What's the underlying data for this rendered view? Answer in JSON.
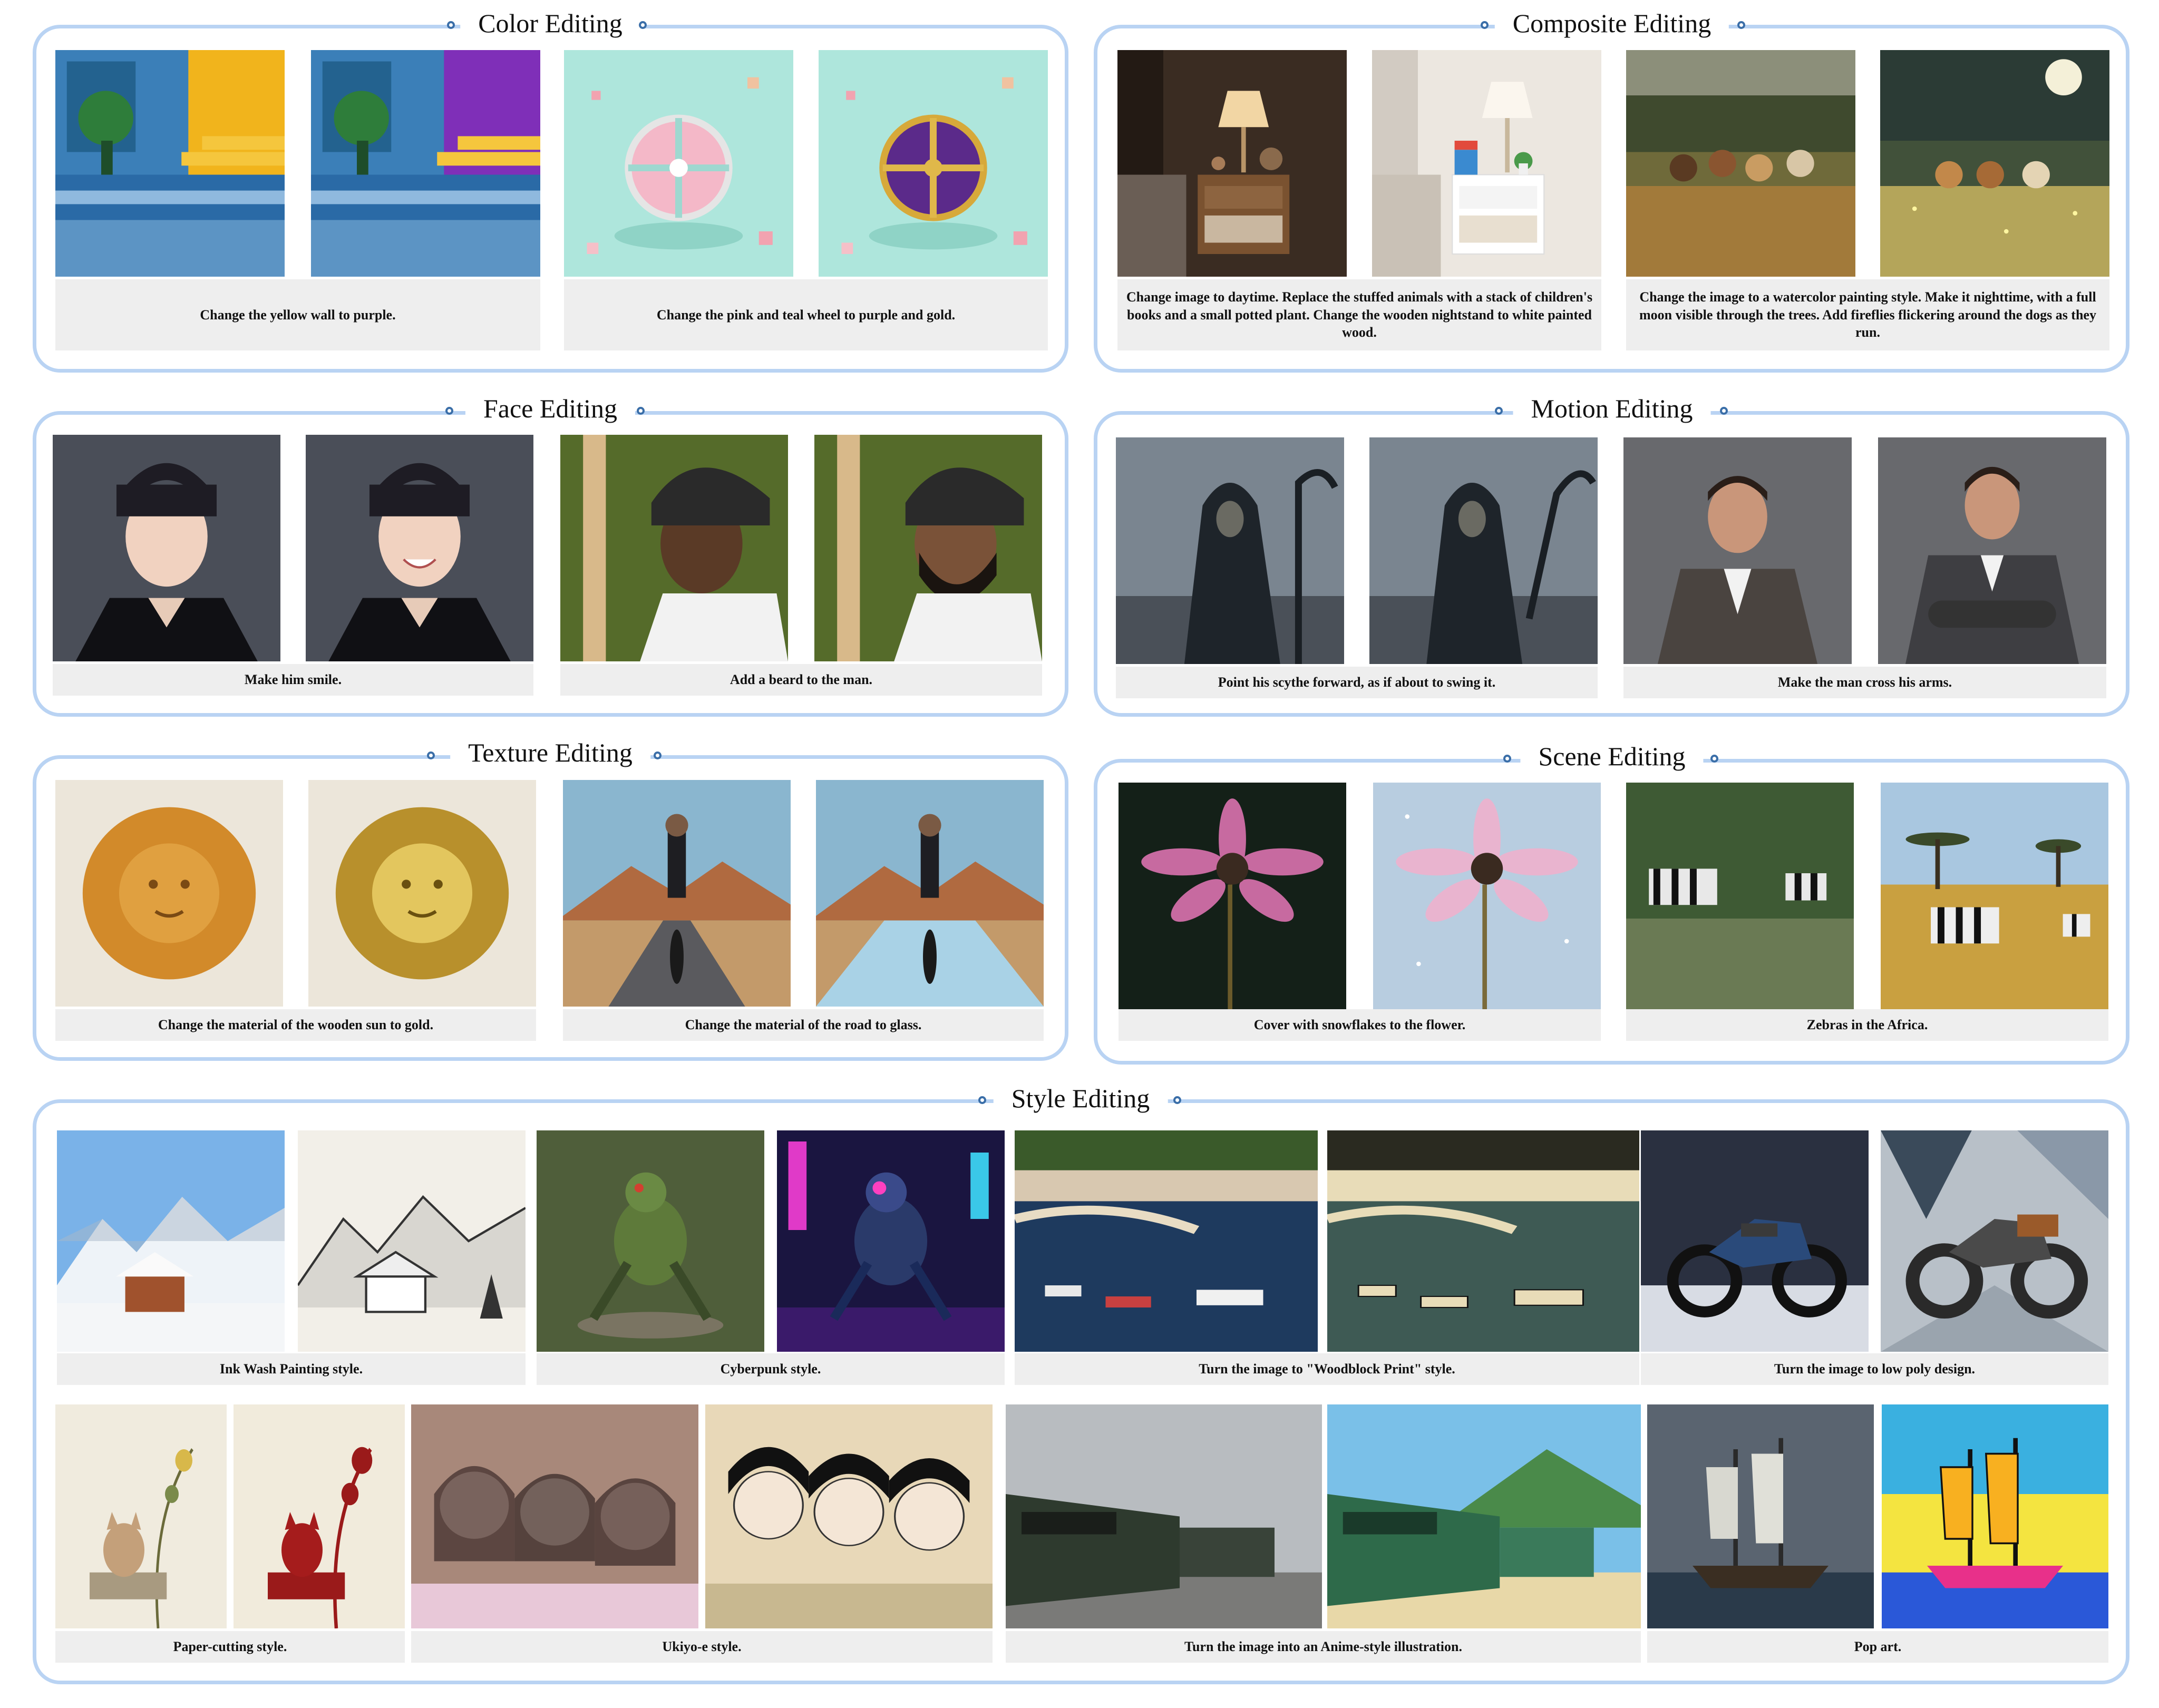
{
  "panels": {
    "color": {
      "title": "Color Editing",
      "captions": [
        "Change the yellow wall to purple.",
        "Change the pink and teal wheel to purple and gold."
      ]
    },
    "composite": {
      "title": "Composite Editing",
      "captions": [
        "Change image to daytime. Replace the stuffed animals  with a stack of children's books and a small potted plant. Change the wooden nightstand to white painted wood.",
        "Change the image to a watercolor painting style. Make it nighttime, with a full moon visible through the trees. Add fireflies flickering around the dogs as they run."
      ]
    },
    "face": {
      "title": "Face Editing",
      "captions": [
        "Make him smile.",
        "Add a beard to the man."
      ]
    },
    "motion": {
      "title": "Motion Editing",
      "captions": [
        "Point his scythe forward, as if about to swing it.",
        "Make the man cross his arms."
      ]
    },
    "texture": {
      "title": "Texture Editing",
      "captions": [
        "Change the material of the wooden sun to gold.",
        "Change the material of the road to glass."
      ]
    },
    "scene": {
      "title": "Scene Editing",
      "captions": [
        "Cover with snowflakes to the flower.",
        "Zebras in the Africa."
      ]
    },
    "style": {
      "title": "Style Editing",
      "row1": [
        "Ink Wash Painting style.",
        "Cyberpunk style.",
        "Turn the image to \"Woodblock Print\" style.",
        "Turn the image to low poly design."
      ],
      "row2": [
        "Paper-cutting style.",
        "Ukiyo-e style.",
        "Turn the image into an Anime-style illustration.",
        "Pop art."
      ]
    }
  },
  "colors": {
    "panel_border": "#b9d3f3",
    "caption_bg": "#eeeeee",
    "title_dot": "#3a6ea8"
  },
  "images": [
    "pool-yellow-wall",
    "pool-purple-wall",
    "pink-teal-wheel",
    "purple-gold-wheel",
    "bedroom-night",
    "bedroom-day",
    "dogs-running",
    "dogs-watercolor-night",
    "anime-boy",
    "anime-boy-smiling",
    "baseball-player",
    "baseball-player-beard",
    "reaper",
    "reaper-scythe-forward",
    "businessman",
    "businessman-crossed-arms",
    "wooden-sun",
    "gold-sun",
    "cyclist-road",
    "cyclist-glass-road",
    "pink-flower",
    "pink-flower-snow",
    "zebras-grass",
    "zebras-savanna",
    "snowy-cabin",
    "ink-wash-cabin",
    "robot-bug",
    "cyberpunk-robot-bug",
    "harbor",
    "woodblock-harbor",
    "motorcycle-snow",
    "low-poly-motorcycle",
    "cat-painting",
    "paper-cut-cat",
    "three-girls",
    "ukiyo-e-girls",
    "train-photo",
    "anime-train",
    "sailing-ship",
    "pop-art-ship"
  ]
}
